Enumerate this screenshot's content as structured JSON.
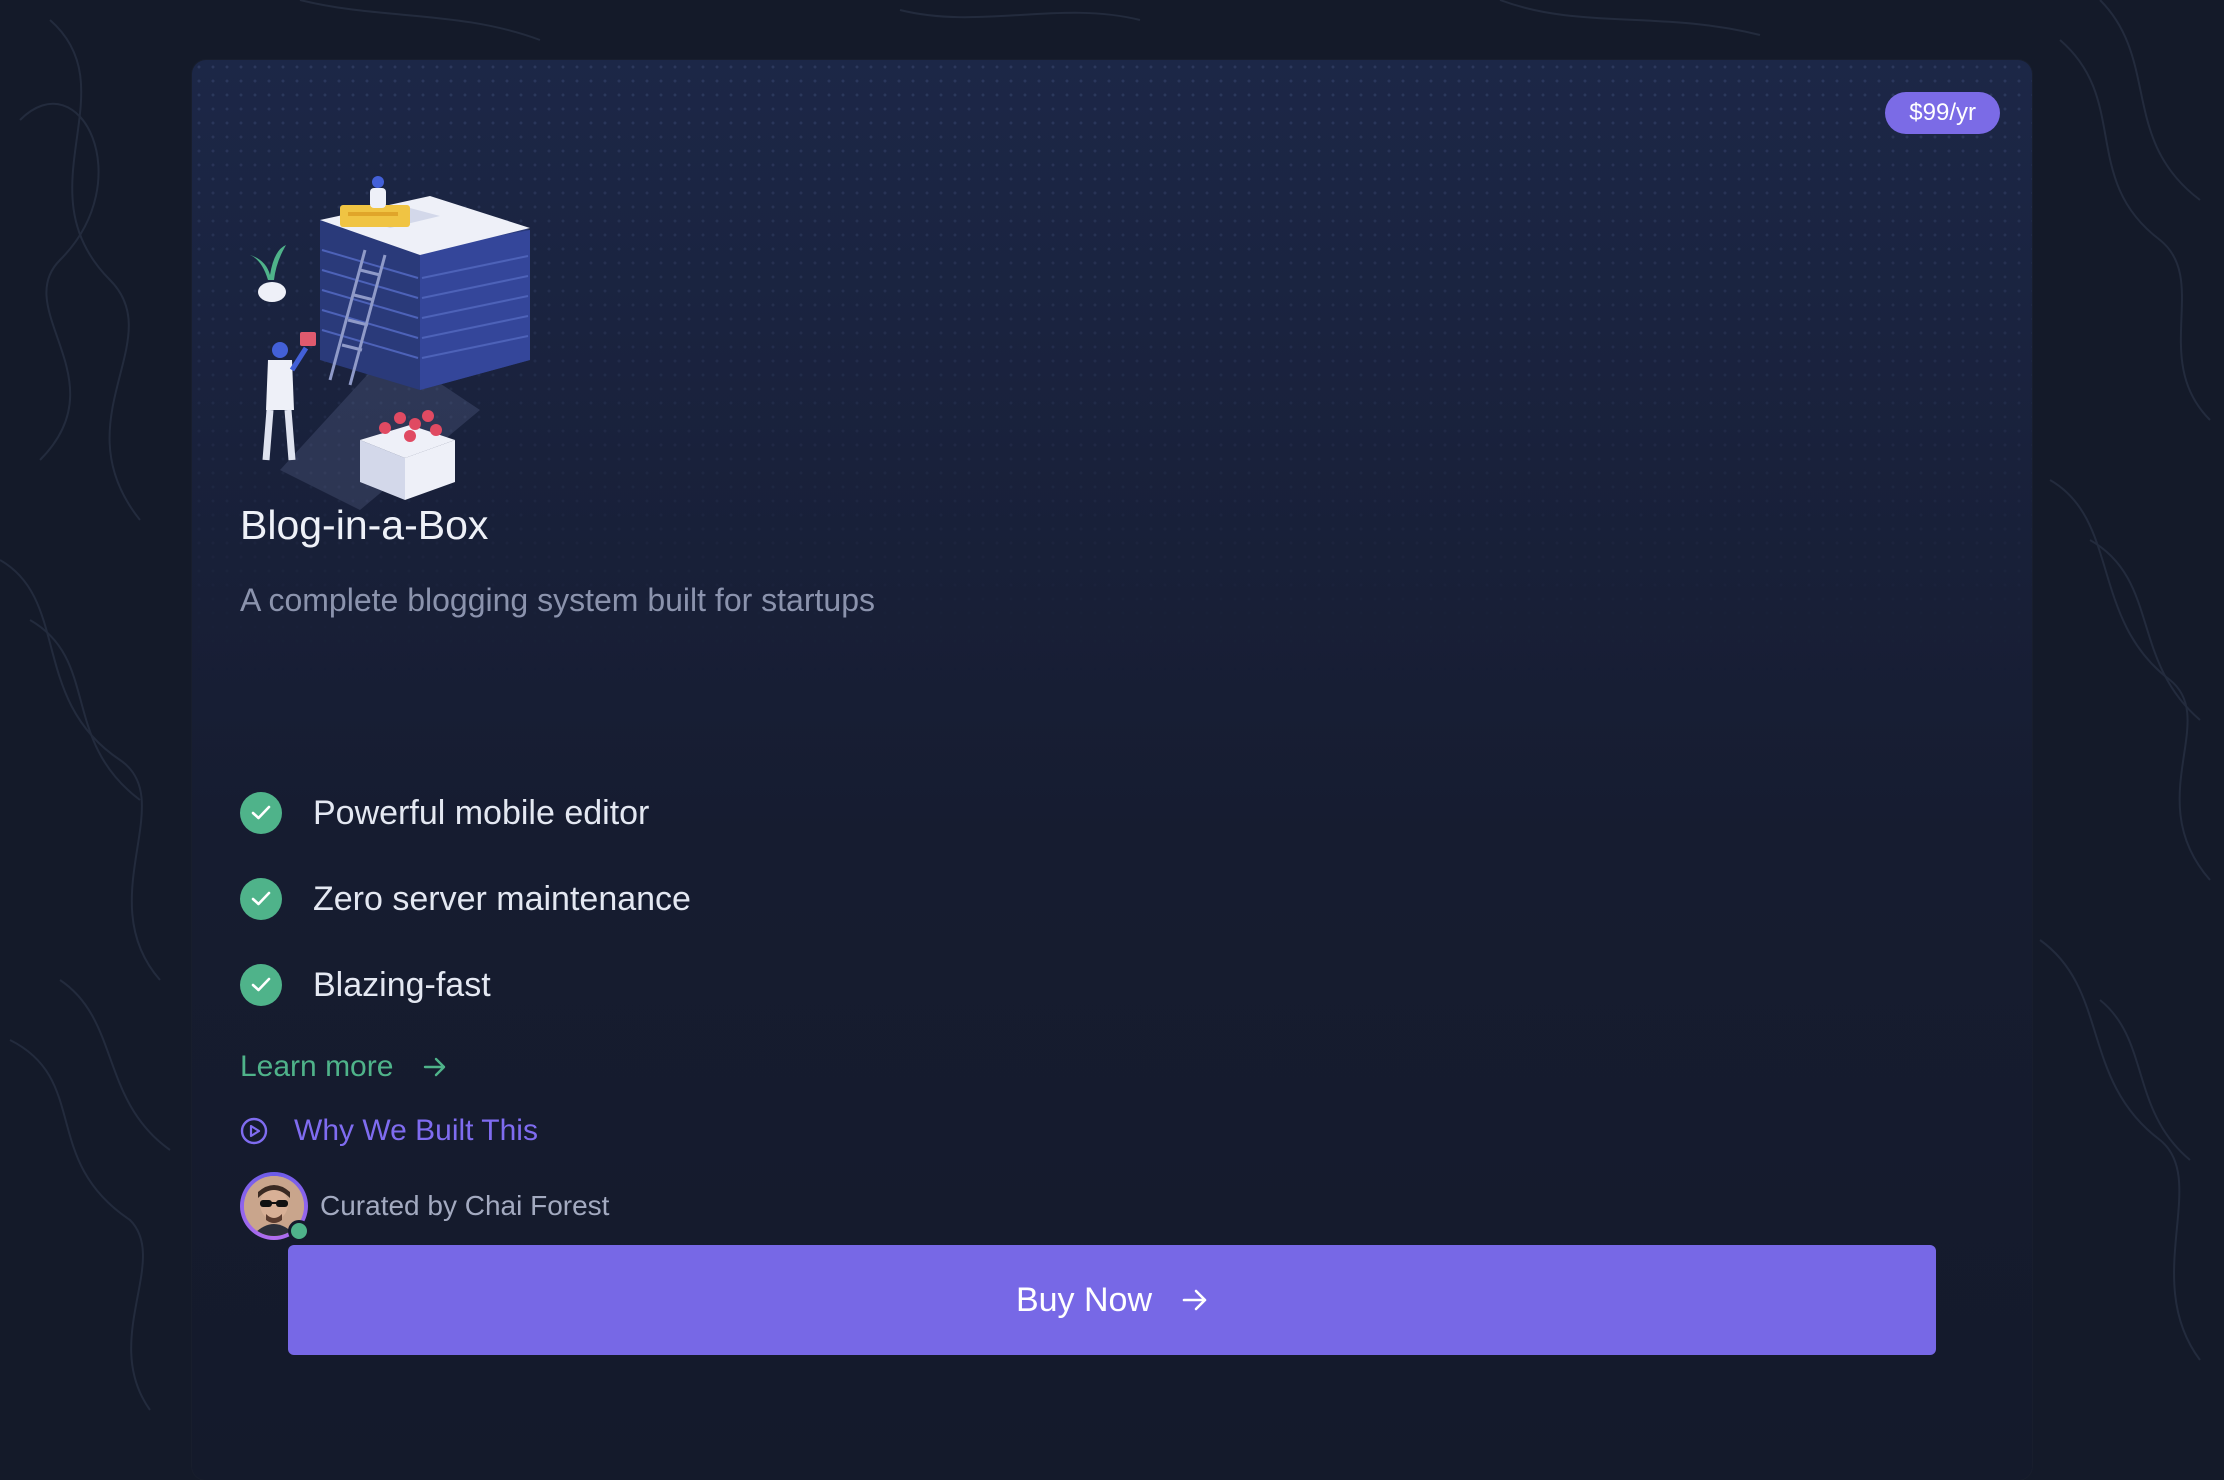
{
  "card": {
    "price": "$99/yr",
    "title": "Blog-in-a-Box",
    "subtitle": "A complete blogging system built for startups",
    "features": [
      {
        "label": "Powerful mobile editor",
        "icon": "check-icon"
      },
      {
        "label": "Zero server maintenance",
        "icon": "check-icon"
      },
      {
        "label": "Blazing-fast",
        "icon": "check-icon"
      }
    ],
    "learn_more": "Learn more",
    "why_link": "Why We Built This",
    "curator": "Curated by Chai Forest",
    "curator_status": "online",
    "buy_label": "Buy Now"
  },
  "colors": {
    "page_background": "#141a29",
    "accent_purple": "#7768e6",
    "accent_green": "#4fb38a",
    "title_text": "#eef1f8",
    "muted_text": "#8b93ad"
  },
  "icons": [
    "arrow-right-icon",
    "play-circle-icon",
    "check-icon"
  ]
}
